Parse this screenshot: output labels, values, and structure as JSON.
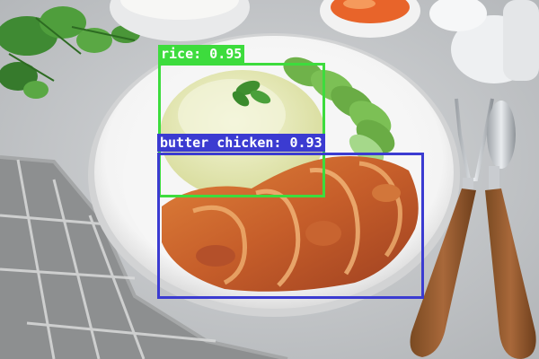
{
  "image": {
    "subject": "plate of fried chicken with rice and cucumber slices",
    "background_color": "#c9cbcd"
  },
  "detections": [
    {
      "label": "rice: 0.95",
      "color": "#3ddc3d"
    },
    {
      "label": "butter chicken: 0.93",
      "color": "#3b3bd1"
    }
  ]
}
